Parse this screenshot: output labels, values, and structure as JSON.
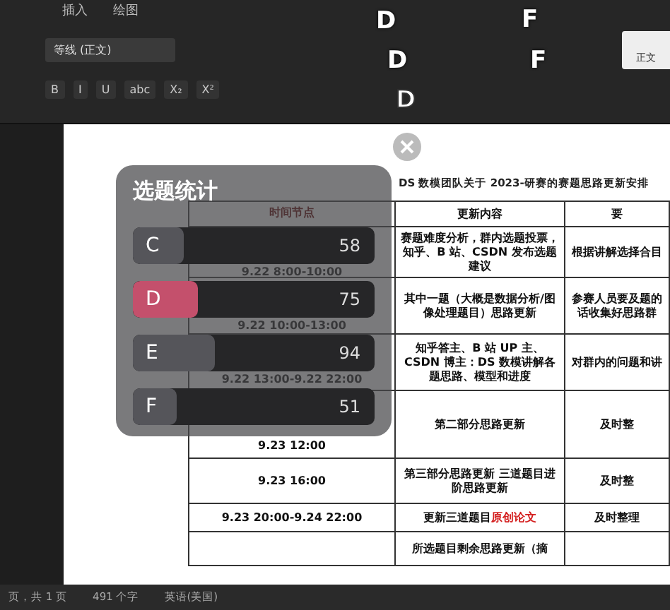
{
  "ribbon": {
    "tabs": [
      {
        "label": "插入",
        "selected": false
      },
      {
        "label": "绘图",
        "selected": false
      }
    ],
    "font_name": "等线 (正文)",
    "format_buttons": [
      "B",
      "I",
      "U",
      "abc",
      "X₂",
      "X²"
    ],
    "style_preview": "正文"
  },
  "floating_letters": [
    {
      "text": "D",
      "kind": "solid"
    },
    {
      "text": "F",
      "kind": "solid"
    },
    {
      "text": "D",
      "kind": "solid"
    },
    {
      "text": "F",
      "kind": "solid"
    },
    {
      "text": "D",
      "kind": "outline"
    }
  ],
  "document": {
    "title": "DS 数模团队关于 2023-研赛的赛题思路更新安排",
    "table": {
      "columns": [
        "时间节点",
        "更新内容",
        "要"
      ],
      "rows": [
        {
          "cells": [
            "9.22 8:00-10:00",
            "赛题难度分析，群内选题投票，知乎、B 站、CSDN 发布选题建议",
            "根据讲解选择合目"
          ]
        },
        {
          "cells": [
            "9.22 10:00-13:00",
            "其中一题（大概是数据分析/图像处理题目）思路更新",
            "参赛人员要及题的话收集好思路群"
          ]
        },
        {
          "cells": [
            "9.22 13:00-9.22 22:00",
            "知乎答主、B 站 UP 主、CSDN 博主：DS 数模讲解各题思路、模型和进度",
            "对群内的问题和讲"
          ]
        },
        {
          "cells": [
            "9.23 12:00",
            "第二部分思路更新",
            "及时整"
          ]
        },
        {
          "cells": [
            "9.23 16:00",
            "第三部分思路更新 三道题目进阶思路更新",
            "及时整"
          ]
        },
        {
          "cells": [
            "9.23 20:00-9.24 22:00",
            "更新三道题目**原创论文**",
            "及时整理"
          ]
        },
        {
          "cells": [
            "",
            "所选题目剩余思路更新（摘",
            ""
          ]
        }
      ]
    }
  },
  "poll": {
    "title": "选题统计",
    "options": [
      {
        "label": "C",
        "count": "58",
        "level": 0.21,
        "selected": false
      },
      {
        "label": "D",
        "count": "75",
        "level": 0.27,
        "selected": true
      },
      {
        "label": "E",
        "count": "94",
        "level": 0.34,
        "selected": false
      },
      {
        "label": "F",
        "count": "51",
        "level": 0.18,
        "selected": false
      }
    ]
  },
  "status_bar": [
    "页，共 1 页",
    "491 个字",
    "英语(美国)"
  ]
}
